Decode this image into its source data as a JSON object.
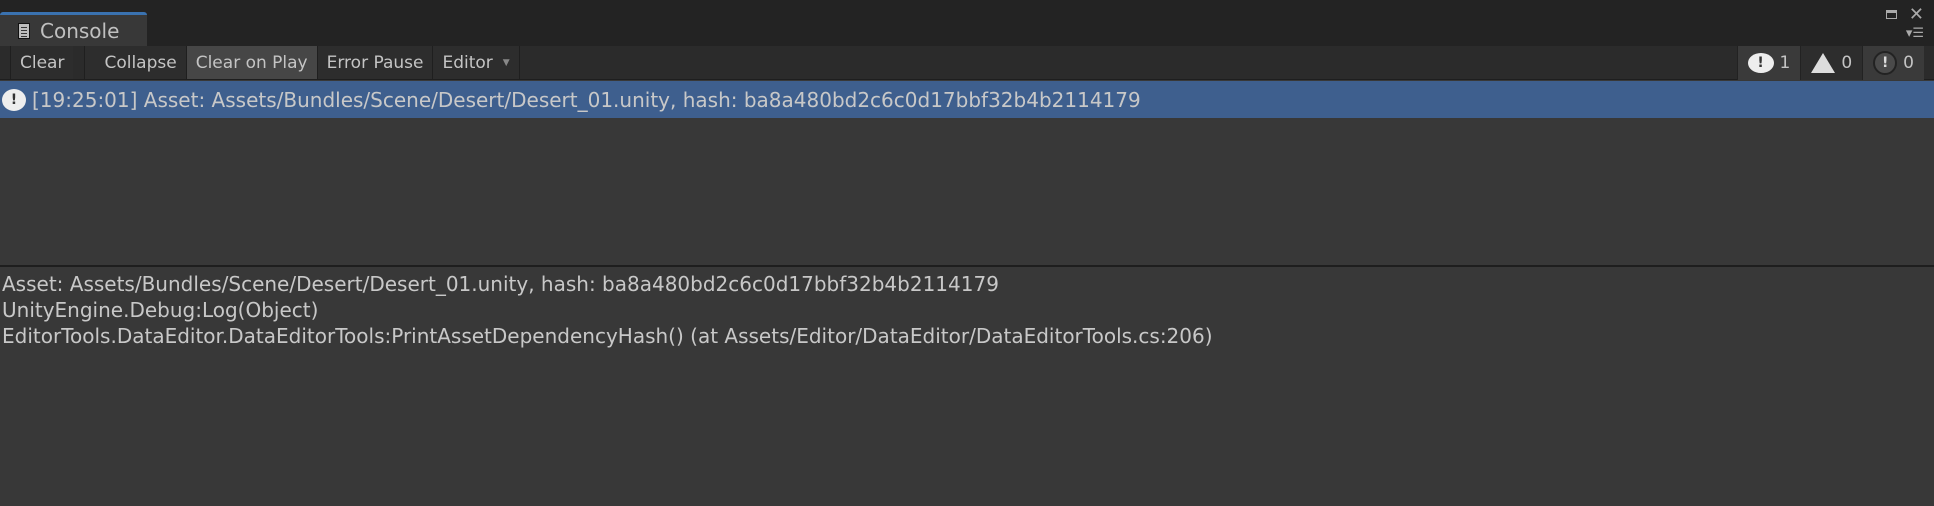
{
  "window": {
    "tab_title": "Console",
    "maximize_icon": "maximize-icon",
    "close_glyph": "✕",
    "menu_glyph": "▾☰"
  },
  "toolbar": {
    "clear": "Clear",
    "collapse": "Collapse",
    "clear_on_play": "Clear on Play",
    "error_pause": "Error Pause",
    "editor": "Editor",
    "editor_arrow": "▼"
  },
  "counts": {
    "log": "1",
    "warning": "0",
    "error": "0"
  },
  "log_entries": [
    {
      "type": "log",
      "text": "[19:25:01] Asset: Assets/Bundles/Scene/Desert/Desert_01.unity, hash: ba8a480bd2c6c0d17bbf32b4b2114179",
      "selected": true
    }
  ],
  "detail": {
    "lines": [
      "Asset: Assets/Bundles/Scene/Desert/Desert_01.unity, hash: ba8a480bd2c6c0d17bbf32b4b2114179",
      "UnityEngine.Debug:Log(Object)",
      "EditorTools.DataEditor.DataEditorTools:PrintAssetDependencyHash() (at Assets/Editor/DataEditor/DataEditorTools.cs:206)"
    ]
  },
  "colors": {
    "selection": "#3e5f8e",
    "tab_accent": "#3a72b0"
  }
}
